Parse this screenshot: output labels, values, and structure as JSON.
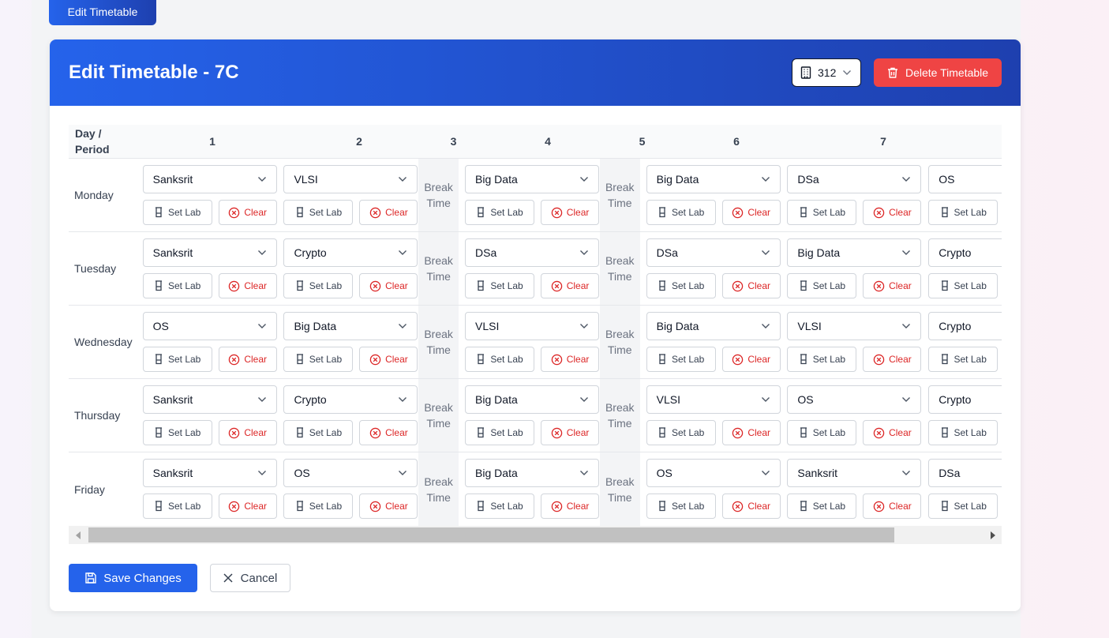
{
  "top_tab": {
    "label": "Edit Timetable"
  },
  "header": {
    "title": "Edit Timetable - 7C",
    "room_value": "312",
    "delete_label": "Delete Timetable"
  },
  "table": {
    "day_header_line1": "Day /",
    "day_header_line2": "Period",
    "periods": [
      "1",
      "2",
      "3",
      "4",
      "5",
      "6",
      "7"
    ],
    "break_label_line1": "Break",
    "break_label_line2": "Time",
    "set_lab_label": "Set Lab",
    "clear_label": "Clear",
    "rows": [
      {
        "day": "Monday",
        "subjects": [
          "Sanksrit",
          "VLSI",
          "Big Data",
          "Big Data",
          "DSa",
          "OS"
        ]
      },
      {
        "day": "Tuesday",
        "subjects": [
          "Sanksrit",
          "Crypto",
          "DSa",
          "DSa",
          "Big Data",
          "Crypto"
        ]
      },
      {
        "day": "Wednesday",
        "subjects": [
          "OS",
          "Big Data",
          "VLSI",
          "Big Data",
          "VLSI",
          "Crypto"
        ]
      },
      {
        "day": "Thursday",
        "subjects": [
          "Sanksrit",
          "Crypto",
          "Big Data",
          "VLSI",
          "OS",
          "Crypto"
        ]
      },
      {
        "day": "Friday",
        "subjects": [
          "Sanksrit",
          "OS",
          "Big Data",
          "OS",
          "Sanksrit",
          "DSa"
        ]
      }
    ]
  },
  "footer": {
    "save_label": "Save Changes",
    "cancel_label": "Cancel"
  },
  "colors": {
    "primary": "#2563eb",
    "primary_dark": "#1e40af",
    "danger": "#ef4444",
    "clear_text": "#dc2626"
  }
}
